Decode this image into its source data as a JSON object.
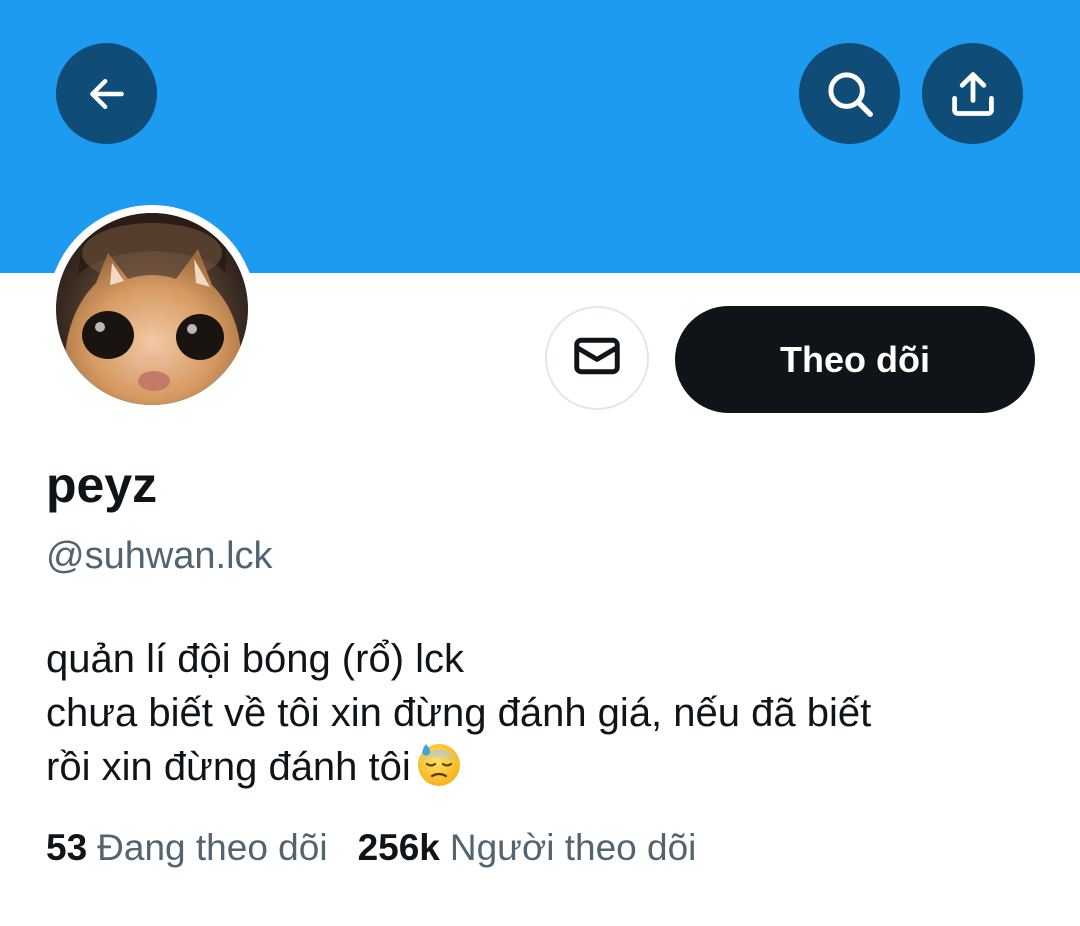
{
  "header": {
    "banner_color": "#1d9bf0",
    "button_color": "#0f4d78",
    "back_icon": "arrow-left-icon",
    "search_icon": "search-icon",
    "share_icon": "share-icon"
  },
  "profile": {
    "avatar": "avatar-photo",
    "display_name": "peyz",
    "handle": "@suhwan.lck",
    "bio_lines": [
      "quản lí đội bóng (rổ) lck",
      "chưa biết về tôi xin đừng đánh giá, nếu đã biết",
      "rồi xin đừng đánh tôi"
    ],
    "bio_emoji": "downcast-face-with-sweat-emoji"
  },
  "actions": {
    "message_icon": "mail-icon",
    "follow_label": "Theo dõi",
    "follow_color": "#0f1419"
  },
  "stats": {
    "following_count": "53",
    "following_label": "Đang theo dõi",
    "followers_count": "256k",
    "followers_label": "Người theo dõi"
  }
}
